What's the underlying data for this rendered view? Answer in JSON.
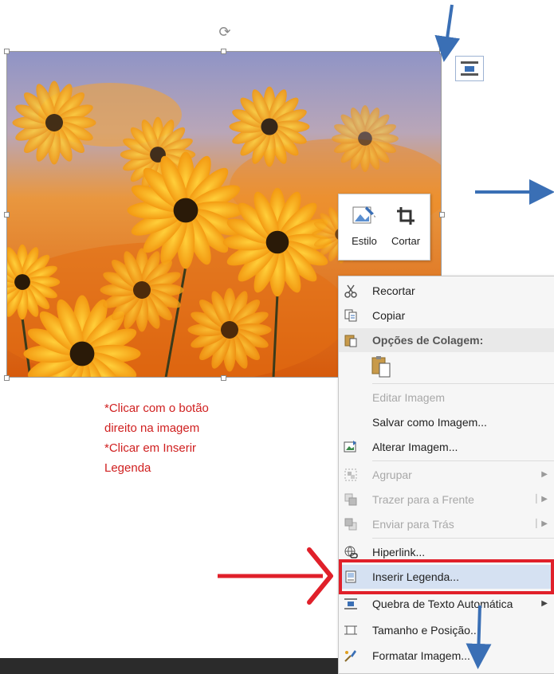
{
  "mini_toolbar": {
    "style_label": "Estilo",
    "crop_label": "Cortar"
  },
  "instructions": {
    "line1": "*Clicar com o botão",
    "line2": "direito na imagem",
    "line3": "*Clicar em Inserir",
    "line4": "Legenda"
  },
  "context_menu": {
    "cut": "Recortar",
    "copy": "Copiar",
    "paste_options": "Opções de Colagem:",
    "edit_image": "Editar Imagem",
    "save_as_image": "Salvar como Imagem...",
    "change_image": "Alterar Imagem...",
    "group": "Agrupar",
    "bring_forward": "Trazer para a Frente",
    "send_backward": "Enviar para Trás",
    "hyperlink": "Hiperlink...",
    "insert_caption": "Inserir Legenda...",
    "wrap_text": "Quebra de Texto Automática",
    "size_position": "Tamanho e Posição...",
    "format_image": "Formatar Imagem..."
  },
  "colors": {
    "annotation_red": "#e0202a",
    "annotation_blue": "#3a6fb5",
    "highlight": "#d5e1f2"
  }
}
